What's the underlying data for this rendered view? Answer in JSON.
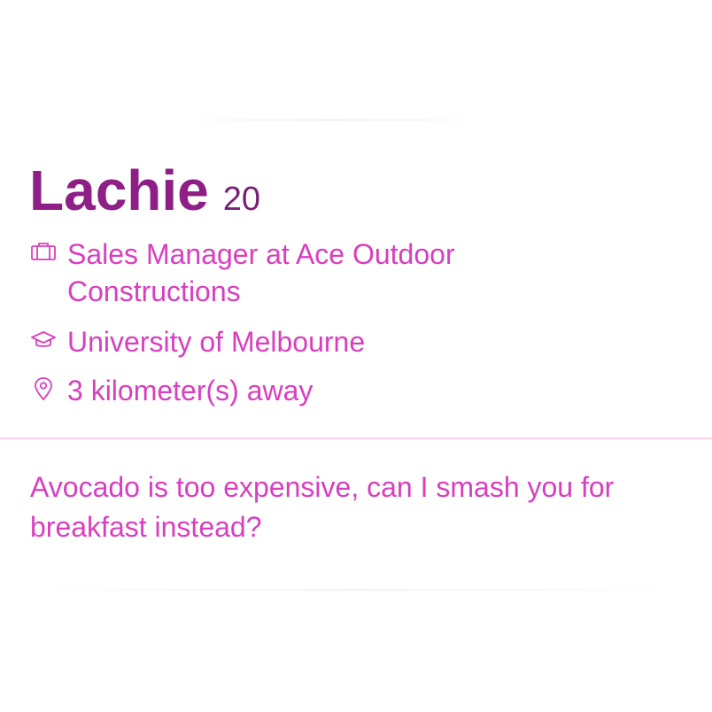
{
  "profile": {
    "name": "Lachie",
    "age": "20",
    "job": "Sales Manager at Ace Outdoor Constructions",
    "school": "University of Melbourne",
    "distance": "3 kilometer(s) away",
    "bio": "Avocado is too expensive, can I smash you for breakfast instead?"
  },
  "icons": {
    "job": "briefcase-icon",
    "school": "graduation-cap-icon",
    "distance": "location-pin-icon"
  },
  "colors": {
    "name": "#8e1f86",
    "age": "#7a1f74",
    "text": "#d83fbf",
    "divider": "#f7d3ee"
  }
}
